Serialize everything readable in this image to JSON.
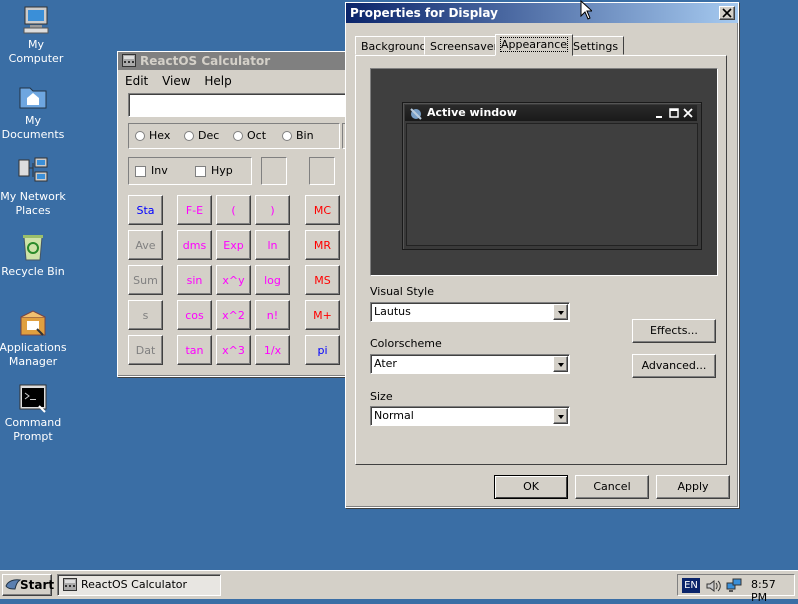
{
  "desktop": {
    "icons": [
      {
        "label": "My Computer"
      },
      {
        "label": "My Documents"
      },
      {
        "label": "My Network Places"
      },
      {
        "label": "Recycle Bin"
      },
      {
        "label": "Applications Manager"
      },
      {
        "label": "Command Prompt"
      }
    ]
  },
  "calculator": {
    "title": "ReactOS Calculator",
    "menu": [
      "Edit",
      "View",
      "Help"
    ],
    "display_value": "",
    "radix": [
      {
        "label": "Hex"
      },
      {
        "label": "Dec"
      },
      {
        "label": "Oct"
      },
      {
        "label": "Bin"
      }
    ],
    "inv_label": "Inv",
    "hyp_label": "Hyp",
    "buttons": [
      [
        "Sta",
        "F-E",
        "(",
        ")",
        "MC"
      ],
      [
        "Ave",
        "dms",
        "Exp",
        "ln",
        "MR"
      ],
      [
        "Sum",
        "sin",
        "x^y",
        "log",
        "MS"
      ],
      [
        "s",
        "cos",
        "x^2",
        "n!",
        "M+"
      ],
      [
        "Dat",
        "tan",
        "x^3",
        "1/x",
        "pi"
      ]
    ]
  },
  "display_props": {
    "title": "Properties for Display",
    "tabs": [
      "Background",
      "Screensaver",
      "Appearance",
      "Settings"
    ],
    "active_tab": "Appearance",
    "preview_title": "Active window",
    "visual_style_label": "Visual Style",
    "visual_style_value": "Lautus",
    "colorscheme_label": "Colorscheme",
    "colorscheme_value": "Ater",
    "size_label": "Size",
    "size_value": "Normal",
    "effects_label": "Effects...",
    "advanced_label": "Advanced...",
    "ok_label": "OK",
    "cancel_label": "Cancel",
    "apply_label": "Apply"
  },
  "taskbar": {
    "start_label": "Start",
    "task_label": "ReactOS Calculator",
    "lang": "EN",
    "clock": "8:57 PM"
  },
  "colors": {
    "desktop": "#3a6ea5",
    "title_active": "#0a246a",
    "face": "#d4d0c8"
  }
}
